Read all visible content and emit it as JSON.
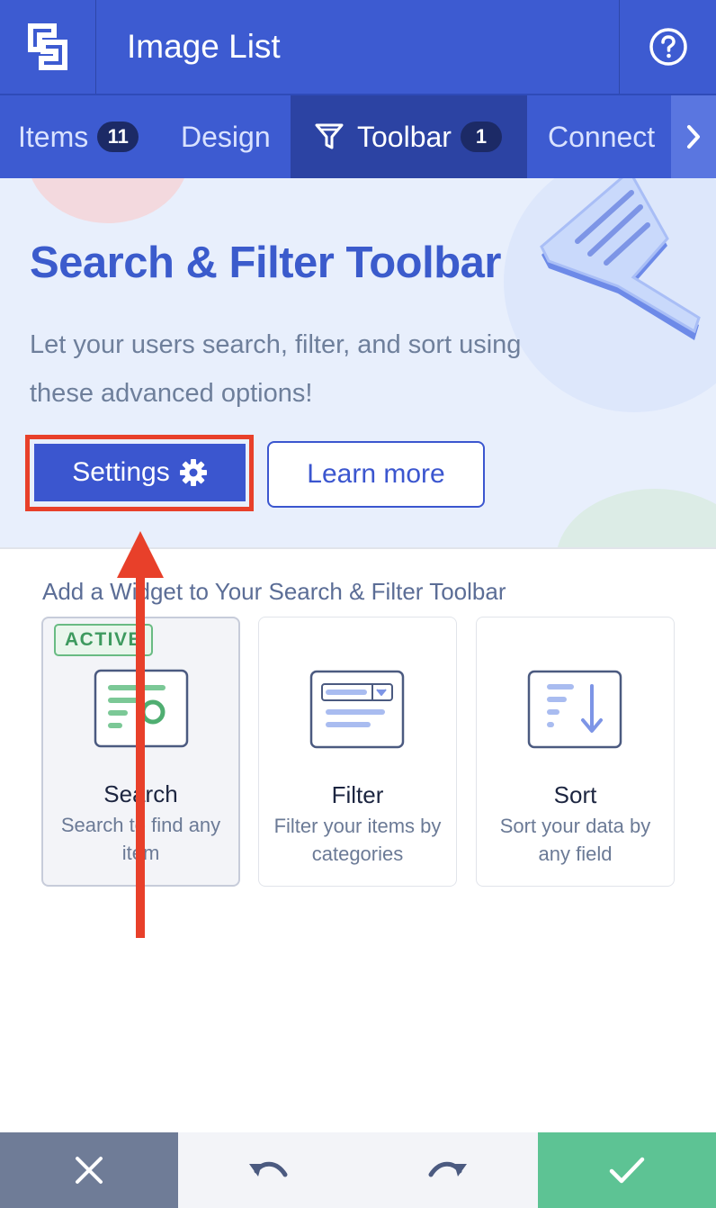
{
  "header": {
    "title": "Image List",
    "logo_icon": "logo-icon",
    "help_icon": "help-circle-icon"
  },
  "tabs": [
    {
      "label": "Items",
      "badge": "11",
      "active": false
    },
    {
      "label": "Design",
      "active": false
    },
    {
      "label": "Toolbar",
      "badge": "1",
      "icon": "funnel-icon",
      "active": true
    },
    {
      "label": "Connect",
      "active": false
    }
  ],
  "tabs_next_icon": "chevron-right-icon",
  "hero": {
    "title": "Search & Filter Toolbar",
    "subtitle": "Let your users search, filter, and sort using these advanced options!",
    "settings_label": "Settings",
    "learn_more_label": "Learn more"
  },
  "widgets": {
    "heading": "Add a Widget to Your Search & Filter Toolbar",
    "items": [
      {
        "title": "Search",
        "description": "Search to find any item",
        "badge": "ACTIVE",
        "active": true
      },
      {
        "title": "Filter",
        "description": "Filter your items by categories",
        "active": false
      },
      {
        "title": "Sort",
        "description": "Sort your data by any field",
        "active": false
      }
    ]
  },
  "bottom_bar": {
    "close_icon": "close-icon",
    "undo_icon": "undo-icon",
    "redo_icon": "redo-icon",
    "confirm_icon": "check-icon"
  },
  "colors": {
    "primary": "#3d5bd1",
    "active_tab": "#2c43a3",
    "accent_red": "#e8402a",
    "success": "#5dc394"
  }
}
